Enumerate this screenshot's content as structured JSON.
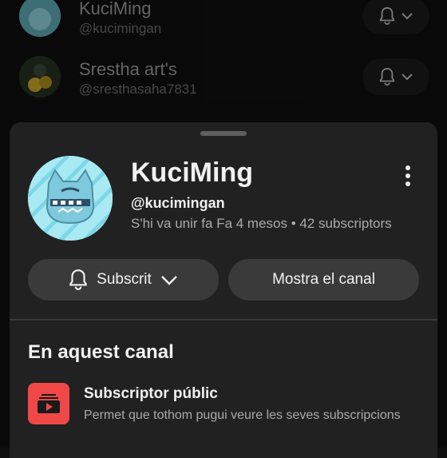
{
  "subscriptions": [
    {
      "name": "KuciMing",
      "handle": "@kucimingan",
      "icon": "bell-icon"
    },
    {
      "name": "Srestha art's",
      "handle": "@sresthasaha7831",
      "icon": "bell-icon"
    }
  ],
  "sheet": {
    "channel_title": "KuciMing",
    "channel_handle": "@kucimingan",
    "channel_meta": "S'hi va unir fa Fa 4 mesos • 42 subscriptors",
    "subscribe_label": "Subscrit",
    "show_channel_label": "Mostra el canal",
    "section_title": "En aquest canal",
    "feature": {
      "title": "Subscriptor públic",
      "description": "Permet que tothom pugui veure les seves subscripcions"
    }
  },
  "colors": {
    "background": "#0f0f0f",
    "sheet": "#212121",
    "button": "#3a3a3a",
    "feature_accent": "#f04848",
    "avatar_cyan": "#9fe6f1"
  }
}
